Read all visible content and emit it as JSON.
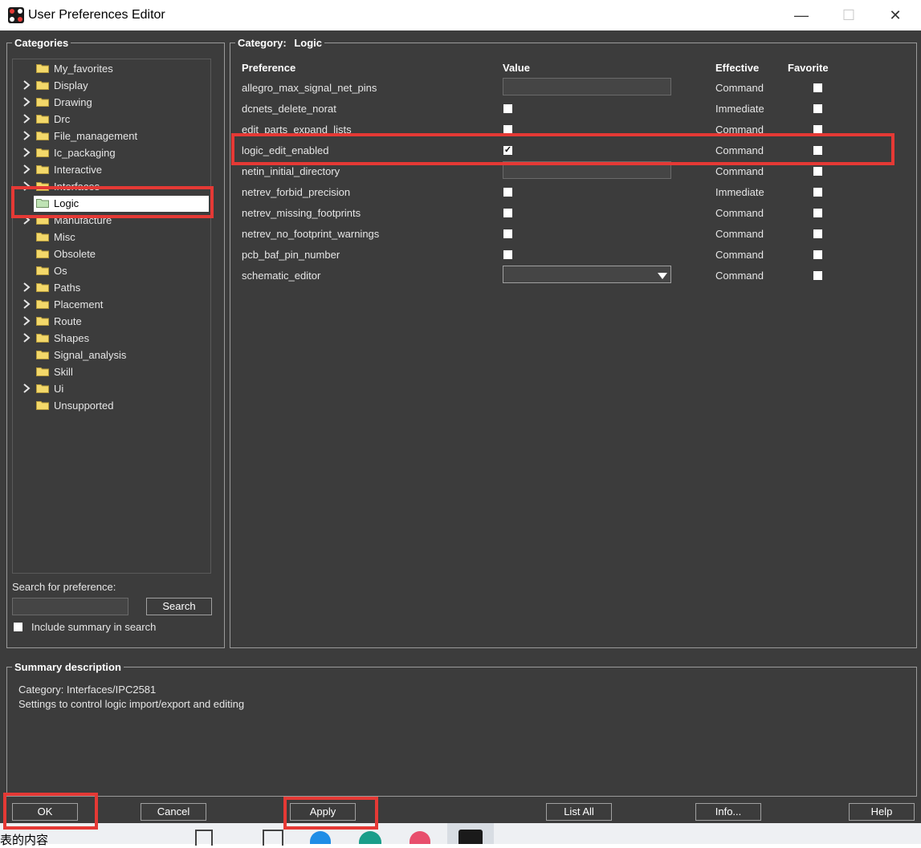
{
  "window": {
    "title": "User Preferences Editor"
  },
  "categories": {
    "label": "Categories",
    "items": [
      {
        "label": "My_favorites",
        "expandable": false
      },
      {
        "label": "Display",
        "expandable": true
      },
      {
        "label": "Drawing",
        "expandable": true
      },
      {
        "label": "Drc",
        "expandable": true
      },
      {
        "label": "File_management",
        "expandable": true
      },
      {
        "label": "Ic_packaging",
        "expandable": true
      },
      {
        "label": "Interactive",
        "expandable": true
      },
      {
        "label": "Interfaces",
        "expandable": true
      },
      {
        "label": "Logic",
        "expandable": false,
        "selected": true
      },
      {
        "label": "Manufacture",
        "expandable": true
      },
      {
        "label": "Misc",
        "expandable": false
      },
      {
        "label": "Obsolete",
        "expandable": false
      },
      {
        "label": "Os",
        "expandable": false
      },
      {
        "label": "Paths",
        "expandable": true
      },
      {
        "label": "Placement",
        "expandable": true
      },
      {
        "label": "Route",
        "expandable": true
      },
      {
        "label": "Shapes",
        "expandable": true
      },
      {
        "label": "Signal_analysis",
        "expandable": false
      },
      {
        "label": "Skill",
        "expandable": false
      },
      {
        "label": "Ui",
        "expandable": true
      },
      {
        "label": "Unsupported",
        "expandable": false
      }
    ],
    "search_label": "Search for preference:",
    "search_value": "",
    "search_button": "Search",
    "include_summary_label": "Include summary in search"
  },
  "category_panel": {
    "label_prefix": "Category:",
    "label_value": "Logic",
    "columns": {
      "preference": "Preference",
      "value": "Value",
      "effective": "Effective",
      "favorite": "Favorite"
    },
    "rows": [
      {
        "name": "allegro_max_signal_net_pins",
        "value_type": "text",
        "value": "",
        "effective": "Command",
        "favorite": false
      },
      {
        "name": "dcnets_delete_norat",
        "value_type": "checkbox",
        "checked": false,
        "effective": "Immediate",
        "favorite": false
      },
      {
        "name": "edit_parts_expand_lists",
        "value_type": "checkbox",
        "checked": false,
        "effective": "Command",
        "favorite": false
      },
      {
        "name": "logic_edit_enabled",
        "value_type": "checkbox",
        "checked": true,
        "check_glyph": "✓",
        "effective": "Command",
        "favorite": false
      },
      {
        "name": "netin_initial_directory",
        "value_type": "text",
        "value": "",
        "effective": "Command",
        "favorite": false
      },
      {
        "name": "netrev_forbid_precision",
        "value_type": "checkbox",
        "checked": false,
        "effective": "Immediate",
        "favorite": false
      },
      {
        "name": "netrev_missing_footprints",
        "value_type": "checkbox",
        "checked": false,
        "effective": "Command",
        "favorite": false
      },
      {
        "name": "netrev_no_footprint_warnings",
        "value_type": "checkbox",
        "checked": false,
        "effective": "Command",
        "favorite": false
      },
      {
        "name": "pcb_baf_pin_number",
        "value_type": "checkbox",
        "checked": false,
        "effective": "Command",
        "favorite": false
      },
      {
        "name": "schematic_editor",
        "value_type": "dropdown",
        "value": "",
        "effective": "Command",
        "favorite": false
      }
    ]
  },
  "summary": {
    "label": "Summary description",
    "line1": "Category: Interfaces/IPC2581",
    "line2": "Settings to control logic import/export and editing"
  },
  "buttons": {
    "ok": "OK",
    "cancel": "Cancel",
    "apply": "Apply",
    "list_all": "List All",
    "info": "Info...",
    "help": "Help"
  },
  "taskbar": {
    "text": "表的内容"
  },
  "colors": {
    "window_bg": "#3c3c3c",
    "highlight": "#e53935",
    "selected_bg": "#ffffff"
  }
}
